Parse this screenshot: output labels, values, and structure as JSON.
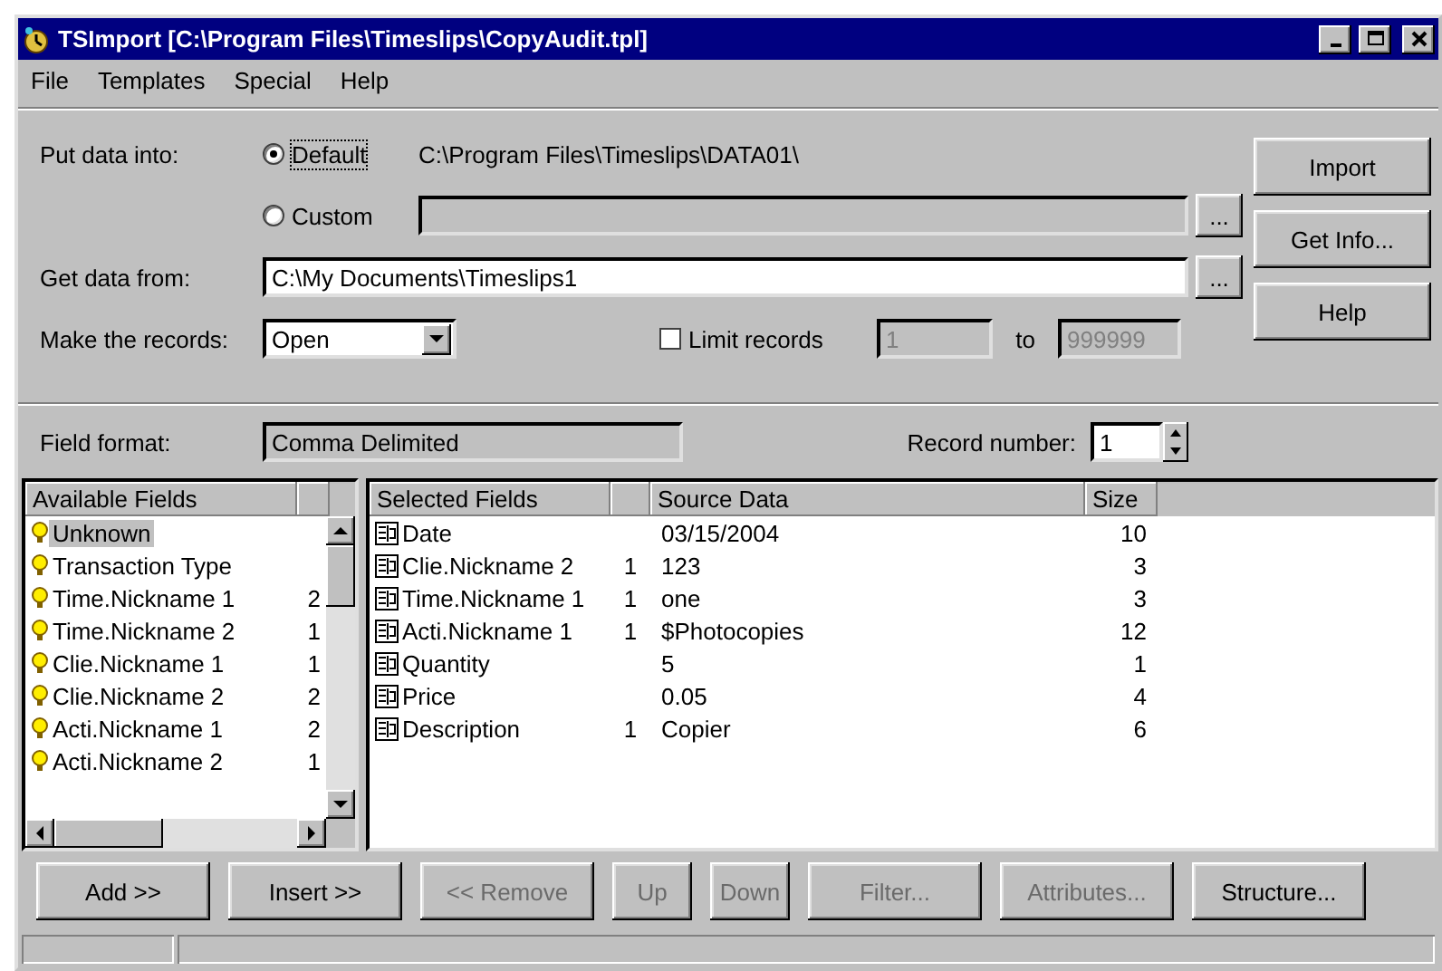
{
  "window": {
    "title": "TSImport [C:\\Program Files\\Timeslips\\CopyAudit.tpl]"
  },
  "menu": [
    {
      "label": "File"
    },
    {
      "label": "Templates"
    },
    {
      "label": "Special"
    },
    {
      "label": "Help"
    }
  ],
  "put_data_into": {
    "label": "Put data into:",
    "options": [
      {
        "label": "Default",
        "selected": true,
        "kind": "path",
        "path": "C:\\Program Files\\Timeslips\\DATA01\\"
      },
      {
        "label": "Custom",
        "selected": false,
        "kind": "field",
        "browse_button": "..."
      }
    ]
  },
  "get_data_from": {
    "label": "Get data from:",
    "value": "C:\\My Documents\\Timeslips1",
    "browse_button": "..."
  },
  "make_records": {
    "label": "Make the records:",
    "value": "Open"
  },
  "limit_records": {
    "label": "Limit records",
    "checked": false,
    "from": "1",
    "to_label": "to",
    "to": "999999"
  },
  "side_buttons": [
    {
      "label": "Import"
    },
    {
      "label": "Get Info..."
    },
    {
      "label": "Help"
    }
  ],
  "field_format": {
    "label": "Field format:",
    "value": "Comma Delimited"
  },
  "record_number": {
    "label": "Record number:",
    "value": "1"
  },
  "available_fields": {
    "header": "Available Fields",
    "items": [
      {
        "name": "Unknown",
        "selected": true
      },
      {
        "name": "Transaction Type",
        "selected": false
      },
      {
        "name": "Time.Nickname 1",
        "count": "2",
        "selected": false
      },
      {
        "name": "Time.Nickname 2",
        "count": "1",
        "selected": false
      },
      {
        "name": "Clie.Nickname 1",
        "count": "1",
        "selected": false
      },
      {
        "name": "Clie.Nickname 2",
        "count": "2",
        "selected": false
      },
      {
        "name": "Acti.Nickname 1",
        "count": "2",
        "selected": false
      },
      {
        "name": "Acti.Nickname 2",
        "count": "1",
        "selected": false
      }
    ]
  },
  "selected_fields": {
    "columns": [
      {
        "label": "Selected Fields"
      },
      {
        "label": "Source Data"
      },
      {
        "label": "Size"
      }
    ],
    "rows": [
      {
        "field": "Date",
        "source": "03/15/2004",
        "size": "10"
      },
      {
        "field": "Clie.Nickname 2",
        "index": "1",
        "source": "123",
        "size": "3"
      },
      {
        "field": "Time.Nickname 1",
        "index": "1",
        "source": "one",
        "size": "3"
      },
      {
        "field": "Acti.Nickname 1",
        "index": "1",
        "source": "$Photocopies",
        "size": "12"
      },
      {
        "field": "Quantity",
        "source": "5",
        "size": "1"
      },
      {
        "field": "Price",
        "source": "0.05",
        "size": "4"
      },
      {
        "field": "Description",
        "index": "1",
        "source": "Copier",
        "size": "6"
      }
    ]
  },
  "buttons": [
    {
      "label": "Add >>",
      "disabled": false
    },
    {
      "label": "Insert >>",
      "disabled": false
    },
    {
      "label": "<< Remove",
      "disabled": true
    },
    {
      "label": "Up",
      "disabled": true
    },
    {
      "label": "Down",
      "disabled": true
    },
    {
      "label": "Filter...",
      "disabled": true
    },
    {
      "label": "Attributes...",
      "disabled": true
    },
    {
      "label": "Structure...",
      "disabled": false
    }
  ]
}
